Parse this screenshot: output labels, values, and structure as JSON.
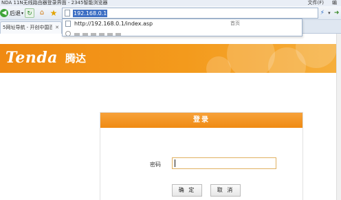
{
  "window": {
    "title": "NDA 11N无线路由器登录界面 - 2345智能浏览器",
    "menu": [
      "文件(F)",
      "编"
    ]
  },
  "toolbar": {
    "back_label": "后退",
    "address_url": "192.168.0.1"
  },
  "tabs": [
    {
      "label": "5网址导航 - 开创中国百..."
    }
  ],
  "address_dropdown": {
    "suggestion_url": "http://192.168.0.1/index.asp",
    "suggestion_type": "首页"
  },
  "banner": {
    "logo_text": "Tenda",
    "logo_cn": "腾达",
    "color": "#f08a12"
  },
  "login": {
    "title": "登录",
    "password_label": "密码",
    "password_value": "",
    "ok_label": "确 定",
    "cancel_label": "取 消"
  },
  "icons": [
    "back-icon",
    "refresh-icon",
    "home-icon",
    "star-icon",
    "page-icon",
    "bolt-icon",
    "chevron-down-icon",
    "close-icon"
  ]
}
